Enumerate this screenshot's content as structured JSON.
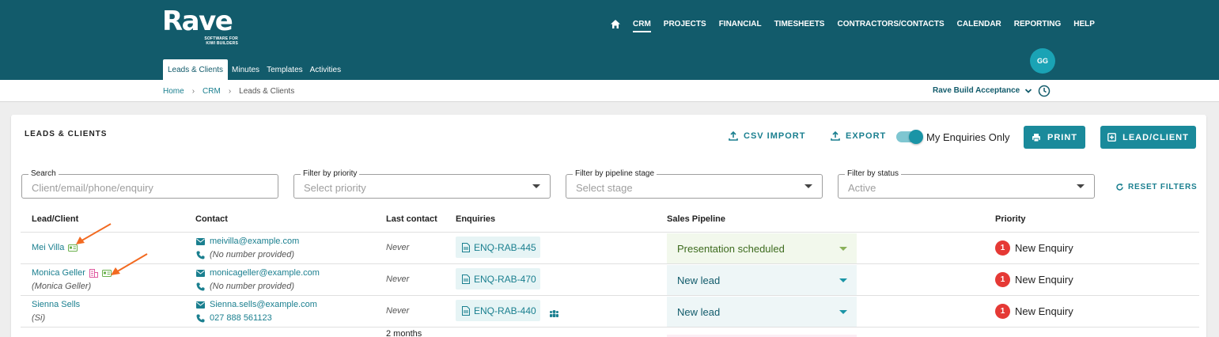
{
  "logo": {
    "wordmark": "Rave",
    "tagline": "SOFTWARE FOR KIWI BUILDERS"
  },
  "nav": {
    "home_icon": "home-icon",
    "items": [
      "CRM",
      "PROJECTS",
      "FINANCIAL",
      "TIMESHEETS",
      "CONTRACTORS/CONTACTS",
      "CALENDAR",
      "REPORTING",
      "HELP"
    ],
    "active": "CRM"
  },
  "user": {
    "initials": "GG"
  },
  "subnav": {
    "items": [
      "Leads & Clients",
      "Minutes",
      "Templates",
      "Activities"
    ],
    "active": "Leads & Clients"
  },
  "breadcrumb": {
    "items": [
      "Home",
      "CRM",
      "Leads & Clients"
    ]
  },
  "company": {
    "name": "Rave Build Acceptance"
  },
  "page": {
    "title": "LEADS & CLIENTS",
    "csv_import": "CSV IMPORT",
    "export": "EXPORT",
    "my_enquiries_label": "My Enquiries Only",
    "my_enquiries_on": true,
    "print": "PRINT",
    "add": "LEAD/CLIENT"
  },
  "filters": {
    "search": {
      "label": "Search",
      "placeholder": "Client/email/phone/enquiry"
    },
    "priority": {
      "label": "Filter by priority",
      "value": "Select priority"
    },
    "stage": {
      "label": "Filter by pipeline stage",
      "value": "Select stage"
    },
    "status": {
      "label": "Filter by status",
      "value": "Active"
    },
    "reset": "RESET FILTERS"
  },
  "table": {
    "columns": [
      "Lead/Client",
      "Contact",
      "Last contact",
      "Enquiries",
      "Sales Pipeline",
      "Priority"
    ],
    "rows": [
      {
        "name": "Mei Villa",
        "alias": "",
        "email": "meivilla@example.com",
        "phone": "(No number provided)",
        "last_contact": "Never",
        "enquiry": "ENQ-RAB-445",
        "pipeline": "Presentation scheduled",
        "priority_num": "1",
        "priority": "New Enquiry"
      },
      {
        "name": "Monica Geller",
        "alias": "(Monica Geller)",
        "email": "monicageller@example.com",
        "phone": "(No number provided)",
        "last_contact": "Never",
        "enquiry": "ENQ-RAB-470",
        "pipeline": "New lead",
        "priority_num": "1",
        "priority": "New Enquiry"
      },
      {
        "name": "Sienna Sells",
        "alias": "(Si)",
        "email": "Sienna.sells@example.com",
        "phone": "027 888 561123",
        "last_contact": "Never",
        "enquiry": "ENQ-RAB-440",
        "pipeline": "New lead",
        "priority_num": "1",
        "priority": "New Enquiry"
      },
      {
        "last_contact": "2 months"
      }
    ]
  },
  "colors": {
    "header": "#125b6b",
    "accent": "#1a8a9b",
    "priority": "#e53935",
    "pipeline_presentation": "#f2f8ec",
    "pipeline_new": "#eef6f7",
    "annotation_arrow": "#f26a21"
  }
}
